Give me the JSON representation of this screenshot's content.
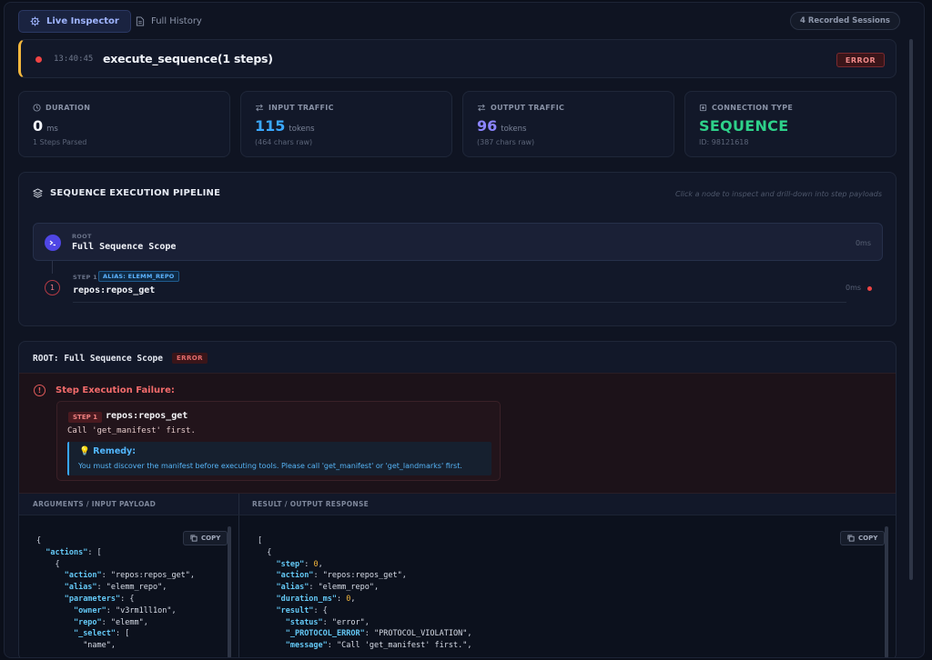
{
  "tabs": {
    "live_label": "Live Inspector",
    "history_label": "Full History",
    "sessions_label": "4 Recorded Sessions"
  },
  "header": {
    "time": "13:40:45",
    "title": "execute_sequence(1 steps)",
    "status": "ERROR"
  },
  "stats": {
    "duration": {
      "label": "DURATION",
      "value": "0",
      "unit": "ms",
      "sub": "1 Steps Parsed"
    },
    "input": {
      "label": "INPUT TRAFFIC",
      "value": "115",
      "unit": "tokens",
      "sub": "(464 chars raw)"
    },
    "output": {
      "label": "OUTPUT TRAFFIC",
      "value": "96",
      "unit": "tokens",
      "sub": "(387 chars raw)"
    },
    "connection": {
      "label": "CONNECTION TYPE",
      "value": "SEQUENCE",
      "sub": "ID: 98121618"
    }
  },
  "pipeline": {
    "title": "SEQUENCE EXECUTION PIPELINE",
    "hint": "Click a node to inspect and drill-down into step payloads",
    "root": {
      "kicker": "ROOT",
      "name": "Full Sequence Scope",
      "time": "0ms"
    },
    "step": {
      "number": "1",
      "kicker": "STEP 1",
      "alias": "ALIAS: ELEMM_REPO",
      "name": "repos:repos_get",
      "time": "0ms"
    }
  },
  "detail": {
    "title": "ROOT: Full Sequence Scope",
    "badge": "ERROR",
    "failure_title": "Step Execution Failure:",
    "step_tag": "STEP 1",
    "step_name": "repos:repos_get",
    "message": "Call 'get_manifest' first.",
    "remedy_title": "Remedy:",
    "remedy_text": "You must discover the manifest before executing tools. Please call 'get_manifest' or 'get_landmarks' first.",
    "args_header": "ARGUMENTS / INPUT PAYLOAD",
    "result_header": "RESULT / OUTPUT RESPONSE",
    "copy_label": "COPY",
    "args_code": [
      {
        "t": "{"
      },
      {
        "k": "\"actions\"",
        "t": ": ["
      },
      {
        "t": "{"
      },
      {
        "k": "\"action\"",
        "t": ": ",
        "s": "\"repos:repos_get\"",
        "e": ","
      },
      {
        "k": "\"alias\"",
        "t": ": ",
        "s": "\"elemm_repo\"",
        "e": ","
      },
      {
        "k": "\"parameters\"",
        "t": ": {"
      },
      {
        "k": "\"owner\"",
        "t": ": ",
        "s": "\"v3rm1ll1on\"",
        "e": ","
      },
      {
        "k": "\"repo\"",
        "t": ": ",
        "s": "\"elemm\"",
        "e": ","
      },
      {
        "k": "\"_select\"",
        "t": ": ["
      },
      {
        "s": "\"name\"",
        "e": ","
      }
    ],
    "result_code": [
      {
        "t": "["
      },
      {
        "t": "{"
      },
      {
        "k": "\"step\"",
        "t": ": ",
        "n": "0",
        "e": ","
      },
      {
        "k": "\"action\"",
        "t": ": ",
        "s": "\"repos:repos_get\"",
        "e": ","
      },
      {
        "k": "\"alias\"",
        "t": ": ",
        "s": "\"elemm_repo\"",
        "e": ","
      },
      {
        "k": "\"duration_ms\"",
        "t": ": ",
        "n": "0",
        "e": ","
      },
      {
        "k": "\"result\"",
        "t": ": {"
      },
      {
        "k": "\"status\"",
        "t": ": ",
        "s": "\"error\"",
        "e": ","
      },
      {
        "k": "\"_PROTOCOL_ERROR\"",
        "t": ": ",
        "s": "\"PROTOCOL_VIOLATION\"",
        "e": ","
      },
      {
        "k": "\"message\"",
        "t": ": ",
        "s": "\"Call 'get_manifest' first.\"",
        "e": ","
      }
    ]
  },
  "colors": {
    "accent": "#9fb4ff",
    "error": "#ef4444",
    "input_value": "#3aa8ff",
    "output_value": "#8b84ff",
    "connection_value": "#2ed18a",
    "json_key": "#64c8f5",
    "json_number": "#f5b83d"
  },
  "icons": {
    "live_tab": "gear-icon",
    "history_tab": "document-icon",
    "duration": "clock-icon",
    "input": "swap-icon",
    "output": "swap-icon",
    "connection": "chip-icon",
    "pipeline": "layers-icon",
    "root_node": "terminal-icon",
    "failure": "shield-alert-icon",
    "remedy": "lightbulb-icon",
    "copy": "copy-icon"
  }
}
